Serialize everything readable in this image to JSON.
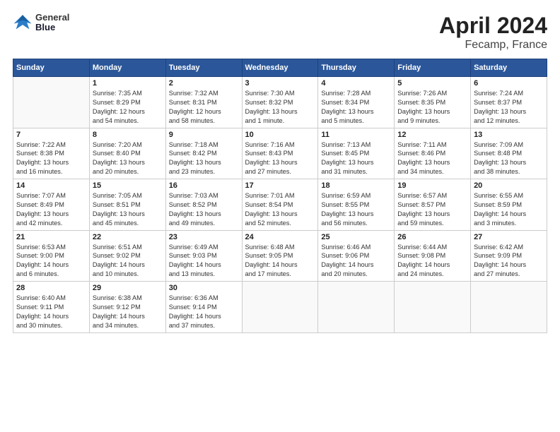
{
  "header": {
    "title": "April 2024",
    "subtitle": "Fecamp, France",
    "logo_line1": "General",
    "logo_line2": "Blue"
  },
  "weekdays": [
    "Sunday",
    "Monday",
    "Tuesday",
    "Wednesday",
    "Thursday",
    "Friday",
    "Saturday"
  ],
  "weeks": [
    [
      {
        "day": "",
        "content": ""
      },
      {
        "day": "1",
        "content": "Sunrise: 7:35 AM\nSunset: 8:29 PM\nDaylight: 12 hours\nand 54 minutes."
      },
      {
        "day": "2",
        "content": "Sunrise: 7:32 AM\nSunset: 8:31 PM\nDaylight: 12 hours\nand 58 minutes."
      },
      {
        "day": "3",
        "content": "Sunrise: 7:30 AM\nSunset: 8:32 PM\nDaylight: 13 hours\nand 1 minute."
      },
      {
        "day": "4",
        "content": "Sunrise: 7:28 AM\nSunset: 8:34 PM\nDaylight: 13 hours\nand 5 minutes."
      },
      {
        "day": "5",
        "content": "Sunrise: 7:26 AM\nSunset: 8:35 PM\nDaylight: 13 hours\nand 9 minutes."
      },
      {
        "day": "6",
        "content": "Sunrise: 7:24 AM\nSunset: 8:37 PM\nDaylight: 13 hours\nand 12 minutes."
      }
    ],
    [
      {
        "day": "7",
        "content": "Sunrise: 7:22 AM\nSunset: 8:38 PM\nDaylight: 13 hours\nand 16 minutes."
      },
      {
        "day": "8",
        "content": "Sunrise: 7:20 AM\nSunset: 8:40 PM\nDaylight: 13 hours\nand 20 minutes."
      },
      {
        "day": "9",
        "content": "Sunrise: 7:18 AM\nSunset: 8:42 PM\nDaylight: 13 hours\nand 23 minutes."
      },
      {
        "day": "10",
        "content": "Sunrise: 7:16 AM\nSunset: 8:43 PM\nDaylight: 13 hours\nand 27 minutes."
      },
      {
        "day": "11",
        "content": "Sunrise: 7:13 AM\nSunset: 8:45 PM\nDaylight: 13 hours\nand 31 minutes."
      },
      {
        "day": "12",
        "content": "Sunrise: 7:11 AM\nSunset: 8:46 PM\nDaylight: 13 hours\nand 34 minutes."
      },
      {
        "day": "13",
        "content": "Sunrise: 7:09 AM\nSunset: 8:48 PM\nDaylight: 13 hours\nand 38 minutes."
      }
    ],
    [
      {
        "day": "14",
        "content": "Sunrise: 7:07 AM\nSunset: 8:49 PM\nDaylight: 13 hours\nand 42 minutes."
      },
      {
        "day": "15",
        "content": "Sunrise: 7:05 AM\nSunset: 8:51 PM\nDaylight: 13 hours\nand 45 minutes."
      },
      {
        "day": "16",
        "content": "Sunrise: 7:03 AM\nSunset: 8:52 PM\nDaylight: 13 hours\nand 49 minutes."
      },
      {
        "day": "17",
        "content": "Sunrise: 7:01 AM\nSunset: 8:54 PM\nDaylight: 13 hours\nand 52 minutes."
      },
      {
        "day": "18",
        "content": "Sunrise: 6:59 AM\nSunset: 8:55 PM\nDaylight: 13 hours\nand 56 minutes."
      },
      {
        "day": "19",
        "content": "Sunrise: 6:57 AM\nSunset: 8:57 PM\nDaylight: 13 hours\nand 59 minutes."
      },
      {
        "day": "20",
        "content": "Sunrise: 6:55 AM\nSunset: 8:59 PM\nDaylight: 14 hours\nand 3 minutes."
      }
    ],
    [
      {
        "day": "21",
        "content": "Sunrise: 6:53 AM\nSunset: 9:00 PM\nDaylight: 14 hours\nand 6 minutes."
      },
      {
        "day": "22",
        "content": "Sunrise: 6:51 AM\nSunset: 9:02 PM\nDaylight: 14 hours\nand 10 minutes."
      },
      {
        "day": "23",
        "content": "Sunrise: 6:49 AM\nSunset: 9:03 PM\nDaylight: 14 hours\nand 13 minutes."
      },
      {
        "day": "24",
        "content": "Sunrise: 6:48 AM\nSunset: 9:05 PM\nDaylight: 14 hours\nand 17 minutes."
      },
      {
        "day": "25",
        "content": "Sunrise: 6:46 AM\nSunset: 9:06 PM\nDaylight: 14 hours\nand 20 minutes."
      },
      {
        "day": "26",
        "content": "Sunrise: 6:44 AM\nSunset: 9:08 PM\nDaylight: 14 hours\nand 24 minutes."
      },
      {
        "day": "27",
        "content": "Sunrise: 6:42 AM\nSunset: 9:09 PM\nDaylight: 14 hours\nand 27 minutes."
      }
    ],
    [
      {
        "day": "28",
        "content": "Sunrise: 6:40 AM\nSunset: 9:11 PM\nDaylight: 14 hours\nand 30 minutes."
      },
      {
        "day": "29",
        "content": "Sunrise: 6:38 AM\nSunset: 9:12 PM\nDaylight: 14 hours\nand 34 minutes."
      },
      {
        "day": "30",
        "content": "Sunrise: 6:36 AM\nSunset: 9:14 PM\nDaylight: 14 hours\nand 37 minutes."
      },
      {
        "day": "",
        "content": ""
      },
      {
        "day": "",
        "content": ""
      },
      {
        "day": "",
        "content": ""
      },
      {
        "day": "",
        "content": ""
      }
    ]
  ]
}
